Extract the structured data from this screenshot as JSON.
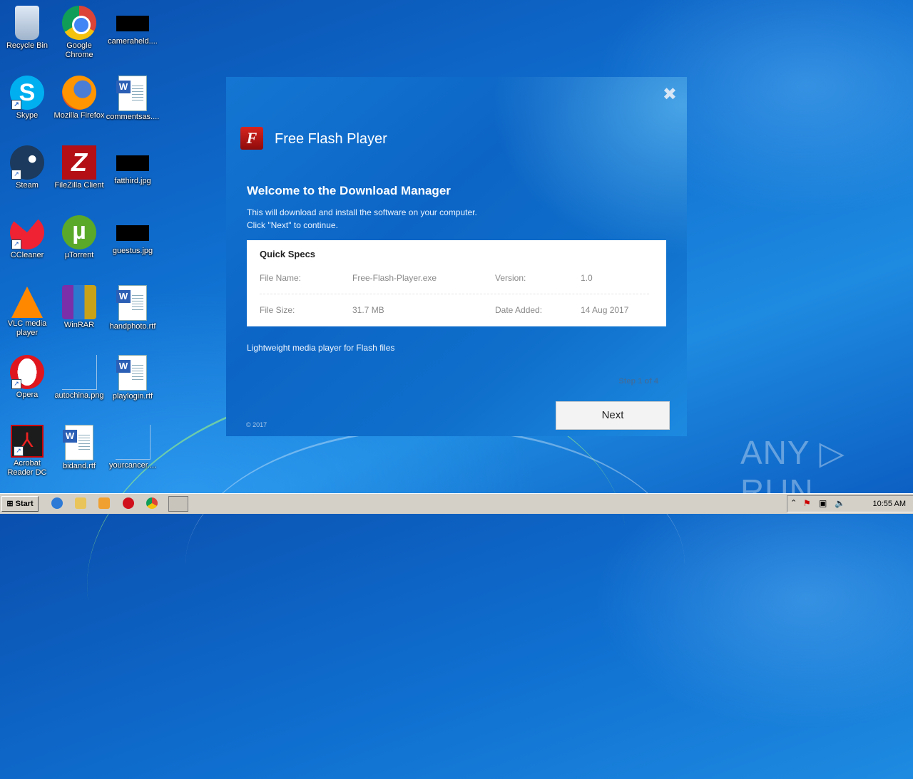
{
  "desktop": {
    "icons": [
      {
        "label": "Recycle Bin",
        "icon": "recycle-bin-icon"
      },
      {
        "label": "Google Chrome",
        "icon": "chrome-icon"
      },
      {
        "label": "cameraheld....",
        "icon": "image-file-icon"
      },
      {
        "label": "Skype",
        "icon": "skype-icon"
      },
      {
        "label": "Mozilla Firefox",
        "icon": "firefox-icon"
      },
      {
        "label": "commentsas....",
        "icon": "word-doc-icon"
      },
      {
        "label": "Steam",
        "icon": "steam-icon"
      },
      {
        "label": "FileZilla Client",
        "icon": "filezilla-icon"
      },
      {
        "label": "fatthird.jpg",
        "icon": "image-file-icon"
      },
      {
        "label": "CCleaner",
        "icon": "ccleaner-icon"
      },
      {
        "label": "µTorrent",
        "icon": "utorrent-icon"
      },
      {
        "label": "guestus.jpg",
        "icon": "image-file-icon"
      },
      {
        "label": "VLC media player",
        "icon": "vlc-icon"
      },
      {
        "label": "WinRAR",
        "icon": "winrar-icon"
      },
      {
        "label": "handphoto.rtf",
        "icon": "word-doc-icon"
      },
      {
        "label": "Opera",
        "icon": "opera-icon"
      },
      {
        "label": "autochina.png",
        "icon": "image-file-icon"
      },
      {
        "label": "playlogin.rtf",
        "icon": "word-doc-icon"
      },
      {
        "label": "Acrobat Reader DC",
        "icon": "acrobat-icon"
      },
      {
        "label": "bidand.rtf",
        "icon": "word-doc-icon"
      },
      {
        "label": "yourcancer....",
        "icon": "file-icon"
      }
    ]
  },
  "installer": {
    "app_title": "Free Flash Player",
    "logo_letter": "F",
    "close_glyph": "✖",
    "heading": "Welcome to the Download Manager",
    "description_line1": "This will download and install the software on your computer.",
    "description_line2": "Click \"Next\" to continue.",
    "specs": {
      "title": "Quick Specs",
      "file_name_label": "File Name:",
      "file_name_value": "Free-Flash-Player.exe",
      "version_label": "Version:",
      "version_value": "1.0",
      "file_size_label": "File Size:",
      "file_size_value": "31.7 MB",
      "date_added_label": "Date Added:",
      "date_added_value": "14 Aug 2017"
    },
    "tagline": "Lightweight media player for Flash files",
    "step_text": "Step 1 of 4",
    "next_label": "Next",
    "copyright": "© 2017"
  },
  "watermark": "ANY ▷ RUN",
  "taskbar": {
    "start_label": "Start",
    "clock": "10:55 AM",
    "quick_launch": [
      "ie-icon",
      "explorer-icon",
      "media-player-icon",
      "opera-icon",
      "chrome-icon",
      "installer-task-icon"
    ],
    "tray_icons": [
      "show-hidden-icon",
      "action-center-icon",
      "network-icon",
      "volume-icon"
    ]
  }
}
